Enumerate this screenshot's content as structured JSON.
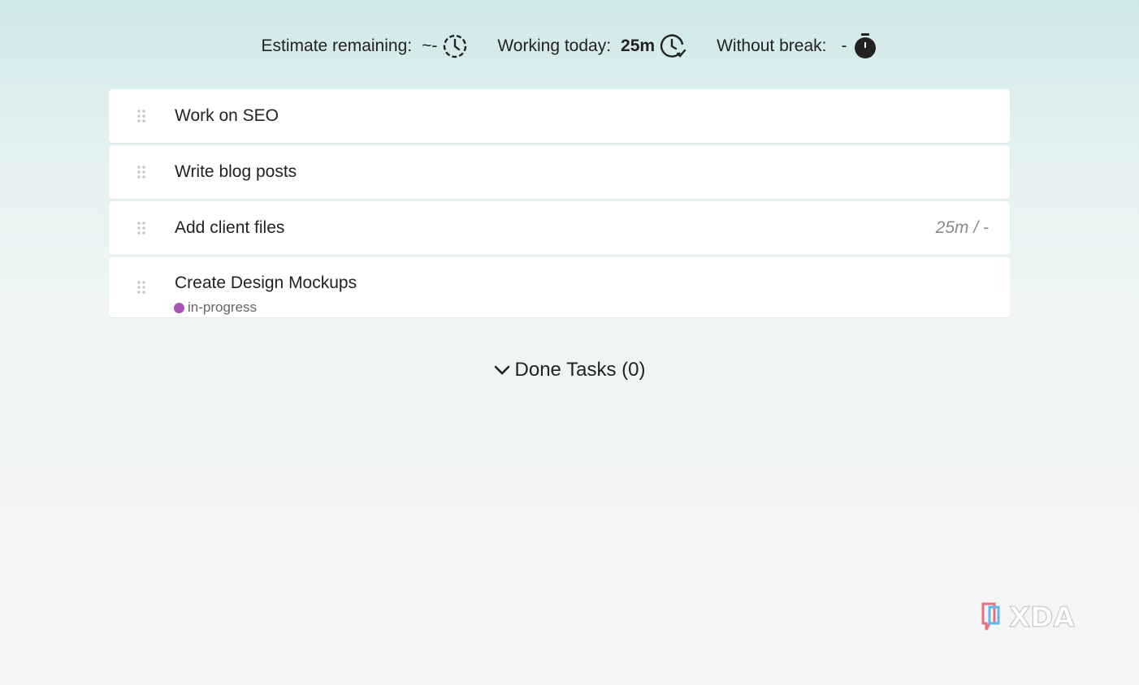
{
  "stats": {
    "estimate_label": "Estimate remaining:",
    "estimate_value": "~-",
    "working_label": "Working today:",
    "working_value": "25m",
    "break_label": "Without break:",
    "break_value": "-"
  },
  "tasks": [
    {
      "title": "Work on SEO",
      "time": "",
      "tag": ""
    },
    {
      "title": "Write blog posts",
      "time": "",
      "tag": ""
    },
    {
      "title": "Add client files",
      "time": "25m / -",
      "tag": ""
    },
    {
      "title": "Create Design Mockups",
      "time": "",
      "tag": "in-progress"
    }
  ],
  "done_tasks_label": "Done Tasks (0)",
  "watermark": "XDA",
  "colors": {
    "tag_in_progress": "#a855b5"
  }
}
